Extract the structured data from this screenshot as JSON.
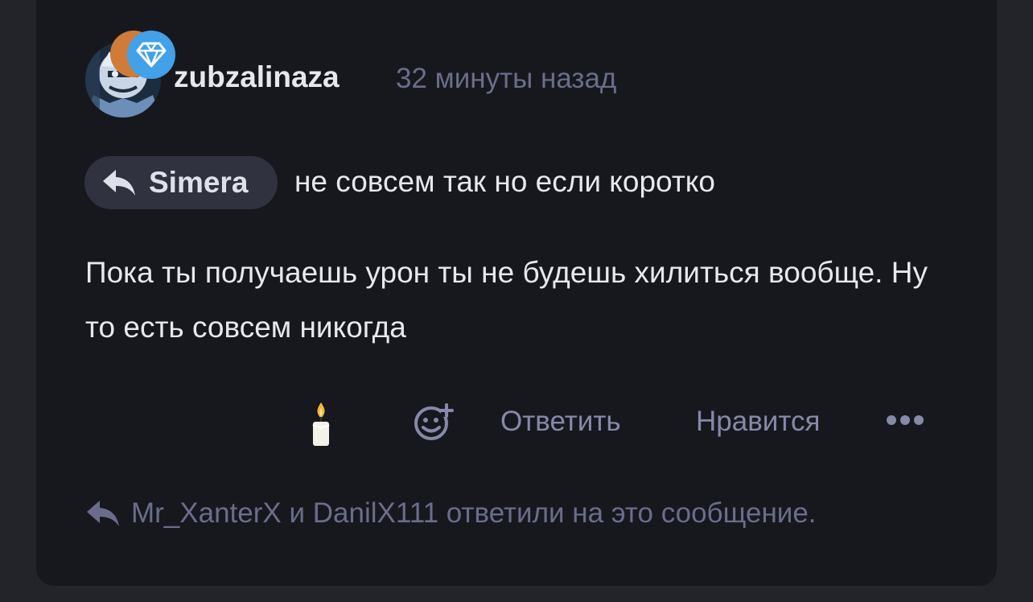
{
  "comment": {
    "author": "zubzalinaza",
    "time": "32 минуты назад",
    "reply_to": {
      "name": "Simera",
      "icon": "reply-arrow-icon"
    },
    "reply_text": "не совсем так но если коротко",
    "body": "Пока ты получаешь урон ты не будешь хилиться вообще. Ну то есть совсем никогда",
    "avatar_icon": "avatar",
    "badges": [
      "coin-badge-icon",
      "diamond-badge-icon"
    ]
  },
  "actions": {
    "candle_icon": "candle-icon",
    "reaction_icon": "add-reaction-icon",
    "reply_label": "Ответить",
    "like_label": "Нравится",
    "more_icon": "more-dots-icon"
  },
  "replies": {
    "icon": "reply-arrow-icon",
    "text": "Mr_XanterX и DanilX111 ответили на это сообщение."
  },
  "colors": {
    "background": "#232429",
    "card": "#17181e",
    "text": "#e7e8ee",
    "muted": "#6a6d8a",
    "action": "#8689a8",
    "chip": "#30323f",
    "badge_blue": "#42a1e8",
    "badge_orange": "#d07b38"
  }
}
